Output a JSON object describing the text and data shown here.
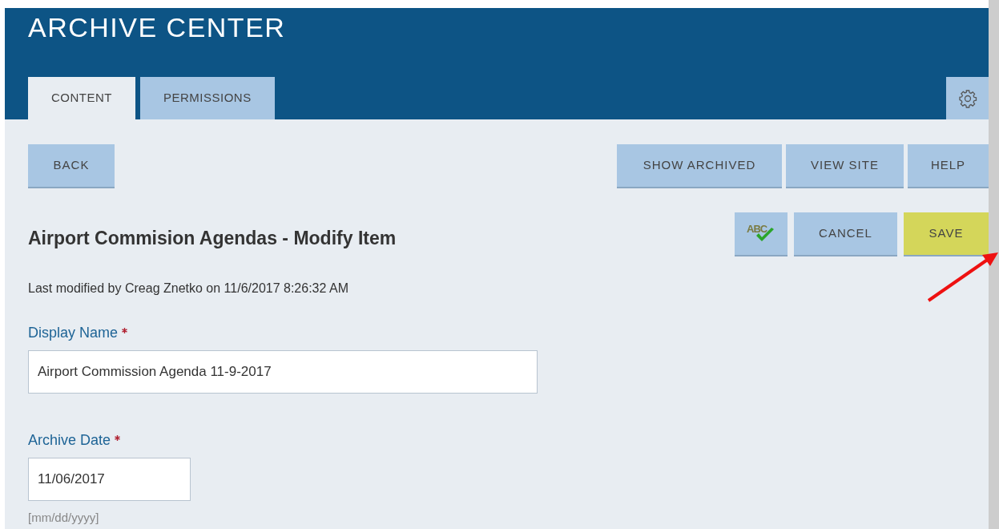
{
  "header": {
    "title": "ARCHIVE CENTER"
  },
  "tabs": [
    {
      "label": "CONTENT",
      "selected": true
    },
    {
      "label": "PERMISSIONS",
      "selected": false
    }
  ],
  "nav_buttons": {
    "left": [
      {
        "label": "BACK",
        "kind": "default"
      }
    ],
    "right": [
      {
        "label": "SHOW ARCHIVED",
        "kind": "default"
      },
      {
        "label": "VIEW SITE",
        "kind": "default"
      },
      {
        "label": "HELP",
        "kind": "default"
      }
    ]
  },
  "page_title": "Airport Commision Agendas - Modify Item",
  "action_buttons": [
    {
      "label": "ABC",
      "kind": "spellcheck"
    },
    {
      "label": "CANCEL",
      "kind": "default"
    },
    {
      "label": "SAVE",
      "kind": "accent"
    }
  ],
  "last_modified": "Last modified by Creag Znetko on 11/6/2017 8:26:32 AM",
  "fields": [
    {
      "label": "Display Name",
      "required": true,
      "value": "Airport Commission Agenda 11-9-2017",
      "kind": "text"
    },
    {
      "label": "Archive Date",
      "required": true,
      "value": "11/06/2017",
      "kind": "date",
      "hint": "[mm/dd/yyyy]"
    }
  ]
}
